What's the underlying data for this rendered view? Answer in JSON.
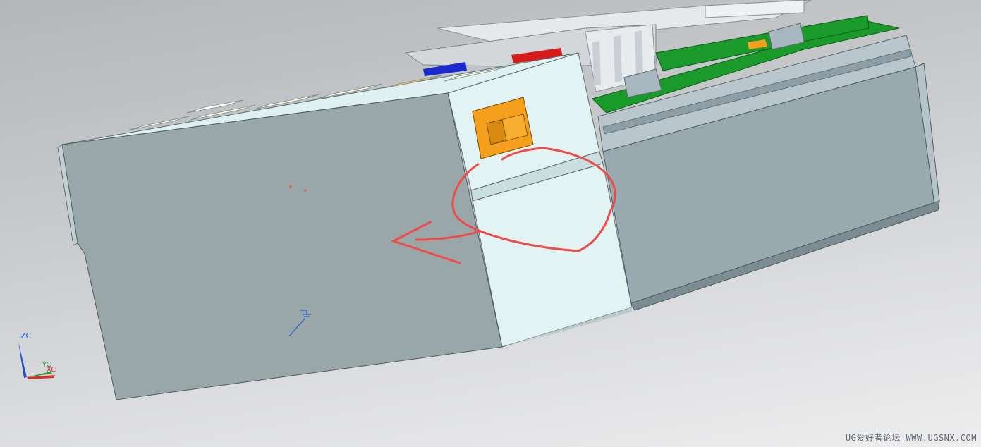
{
  "window": {
    "view": "3D model viewport",
    "background": "#c8cacc"
  },
  "colors": {
    "housing_front": "#9aa7a8",
    "housing_top": "#dff0f0",
    "housing_side_light": "#e2f3f3",
    "right_block": "#99a9b0",
    "pcb_green": "#1a9a2a",
    "switch_orange": "#f5a01c",
    "annotation_red": "#f04a4a",
    "axis_blue": "#1a4fd0",
    "axis_red": "#d43030",
    "axis_green": "#2a9a2a"
  },
  "triad": {
    "z_label": "ZC",
    "y_label": "YC",
    "x_label": "XC"
  },
  "icons": {
    "ground_symbol": "ground-icon",
    "switch": "rocker-switch-icon"
  },
  "annotation": {
    "type": "freehand red circle with arrow",
    "color": "#f04a4a"
  },
  "watermark": "UG爱好者论坛 WWW.UGSNX.COM"
}
